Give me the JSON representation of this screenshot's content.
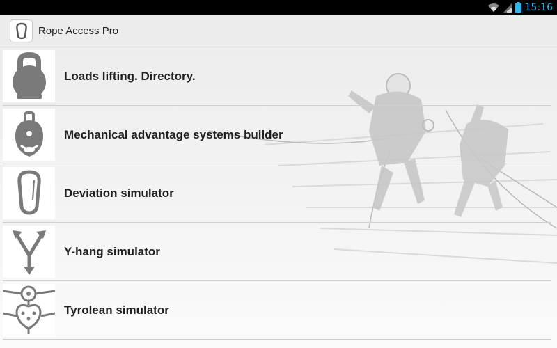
{
  "status_bar": {
    "time": "15:16",
    "icons": [
      "wifi-icon",
      "signal-icon",
      "battery-icon"
    ]
  },
  "action_bar": {
    "title": "Rope Access Pro",
    "app_icon": "carabiner-icon"
  },
  "menu": {
    "items": [
      {
        "label": "Loads lifting. Directory.",
        "icon": "kettlebell-icon"
      },
      {
        "label": "Mechanical advantage systems builder",
        "icon": "pulley-icon"
      },
      {
        "label": "Deviation simulator",
        "icon": "carabiner-icon"
      },
      {
        "label": "Y-hang simulator",
        "icon": "y-hang-icon"
      },
      {
        "label": "Tyrolean simulator",
        "icon": "tyrolean-pulley-icon"
      }
    ]
  },
  "background": {
    "image": "rope-access-climbers-photo"
  },
  "colors": {
    "status_bar": "#000000",
    "clock": "#33b5e5",
    "action_bar": "#ececec",
    "icon_gray": "#7a7a7a"
  }
}
